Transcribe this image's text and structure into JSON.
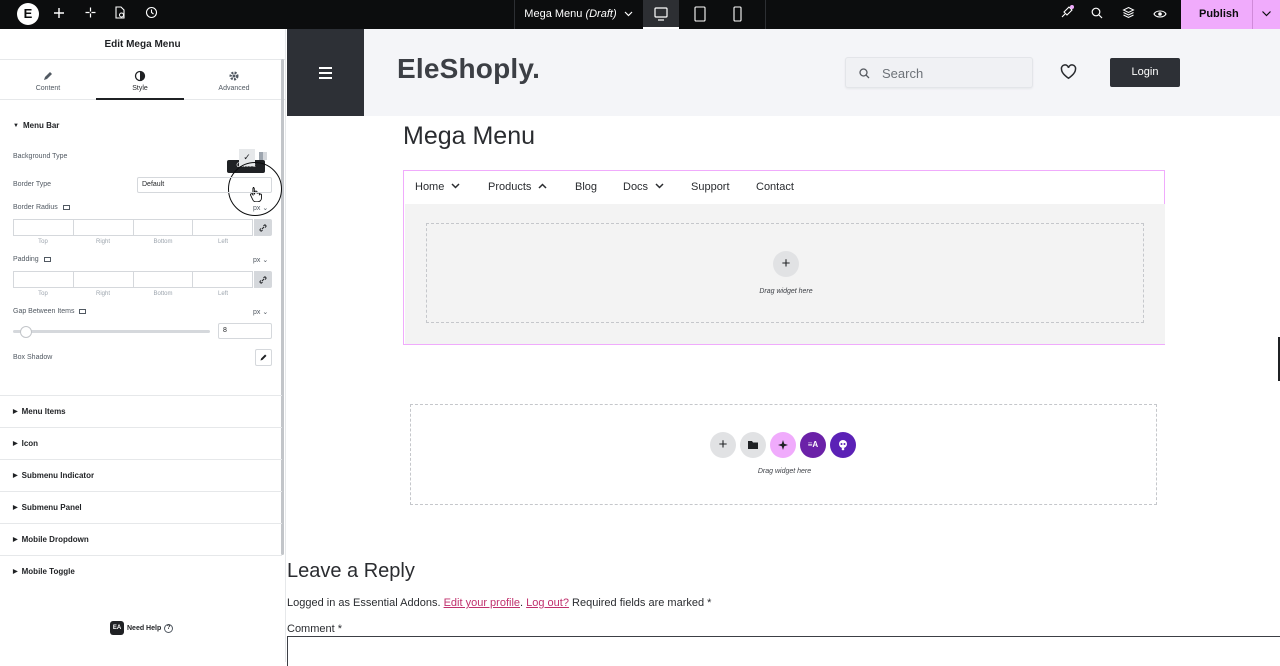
{
  "topbar": {
    "logo": "E",
    "document_title": "Mega Menu",
    "document_status": "(Draft)",
    "publish_label": "Publish",
    "accent": "#f0abfc"
  },
  "panel": {
    "title": "Edit Mega Menu",
    "tabs": [
      {
        "label": "Content",
        "icon": "pencil-icon"
      },
      {
        "label": "Style",
        "icon": "contrast-icon"
      },
      {
        "label": "Advanced",
        "icon": "gear-icon"
      }
    ],
    "active_tab": "Style",
    "menu_bar": {
      "title": "Menu Bar",
      "background_type_label": "Background Type",
      "tooltip": "Classic",
      "border_type_label": "Border Type",
      "border_type_value": "Default",
      "border_radius_label": "Border Radius",
      "unit": "px",
      "dims": [
        "Top",
        "Right",
        "Bottom",
        "Left"
      ],
      "padding_label": "Padding",
      "gap_label": "Gap Between Items",
      "gap_value": "8",
      "box_shadow_label": "Box Shadow"
    },
    "sections": [
      "Menu Items",
      "Icon",
      "Submenu Indicator",
      "Submenu Panel",
      "Mobile Dropdown",
      "Mobile Toggle"
    ],
    "need_help": "Need Help",
    "need_help_logo": "EA"
  },
  "site": {
    "brand": "EleShoply.",
    "search_placeholder": "Search",
    "login_label": "Login",
    "page_title": "Mega Menu",
    "menu": [
      {
        "label": "Home",
        "chevron": "down"
      },
      {
        "label": "Products",
        "chevron": "up"
      },
      {
        "label": "Blog",
        "chevron": ""
      },
      {
        "label": "Docs",
        "chevron": "down"
      },
      {
        "label": "Support",
        "chevron": ""
      },
      {
        "label": "Contact",
        "chevron": ""
      }
    ],
    "drag_widget_text": "Drag widget here",
    "reply_title": "Leave a Reply",
    "logged_in_prefix": "Logged in as Essential Addons.",
    "edit_profile": "Edit your profile",
    "logout": "Log out?",
    "required_text": "Required fields are marked *",
    "comment_label": "Comment *"
  }
}
